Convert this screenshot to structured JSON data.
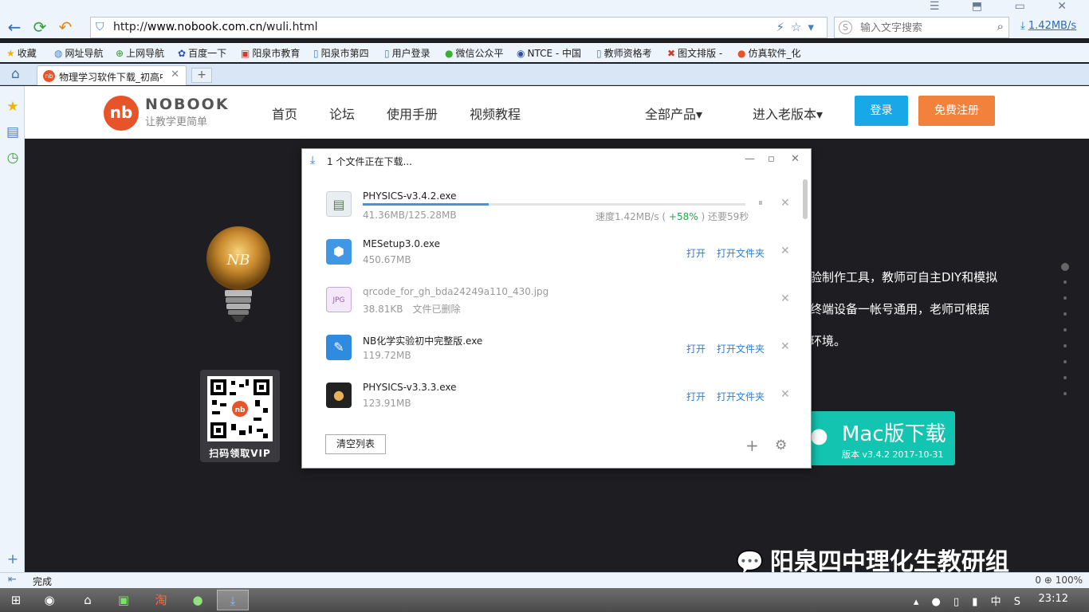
{
  "browser": {
    "url_prefix": "http://",
    "url_domain": "www.nobook.com.cn",
    "url_path": "/wuli.html",
    "search_placeholder": "输入文字搜索",
    "download_rate": "1.42MB/s",
    "bookmarks": [
      {
        "label": "收藏",
        "icon": "star-icon"
      },
      {
        "label": "网址导航",
        "icon": "globe-icon"
      },
      {
        "label": "上网导航",
        "icon": "plus-circle-icon"
      },
      {
        "label": "百度一下",
        "icon": "baidu-icon"
      },
      {
        "label": "阳泉市教育",
        "icon": "page-icon"
      },
      {
        "label": "阳泉市第四",
        "icon": "page-icon"
      },
      {
        "label": "用户登录",
        "icon": "page-icon"
      },
      {
        "label": "微信公众平",
        "icon": "wechat-icon"
      },
      {
        "label": "NTCE - 中国",
        "icon": "ntce-icon"
      },
      {
        "label": "教师资格考",
        "icon": "page-icon"
      },
      {
        "label": "图文排版 -",
        "icon": "layout-icon"
      },
      {
        "label": "仿真软件_化",
        "icon": "nobook-icon"
      }
    ],
    "tab_title": "物理学习软件下载_初高中",
    "status_text": "完成",
    "zoom": "100%",
    "status_count": "0"
  },
  "site": {
    "logo_mark": "nb",
    "logo_name": "NOBOOK",
    "logo_slogan": "让教学更简单",
    "nav": [
      "首页",
      "论坛",
      "使用手册",
      "视频教程"
    ],
    "products": "全部产品",
    "old_version": "进入老版本",
    "login": "登录",
    "register": "免费注册",
    "qr_caption": "扫码领取VIP",
    "desc_lines": [
      "验制作工具，教师可自主DIY和模拟",
      "终端设备一帐号通用，老师可根据",
      "环境。"
    ],
    "mac_title": "Mac版下载",
    "mac_version": "版本 v3.4.2   2017-10-31",
    "watermark": "阳泉四中理化生教研组"
  },
  "download_dialog": {
    "title": "1 个文件正在下载...",
    "items": [
      {
        "name": "PHYSICS-v3.4.2.exe",
        "size": "41.36MB/125.28MB",
        "progress": 0.33,
        "speed_prefix": "速度1.42MB/s ( ",
        "speed_pct": "+58%",
        "speed_suffix": " ) 还要59秒",
        "icon": "physics-setup-icon"
      },
      {
        "name": "MESetup3.0.exe",
        "size": "450.67MB",
        "open": "打开",
        "folder": "打开文件夹",
        "icon": "setup-box-icon"
      },
      {
        "name": "qrcode_for_gh_bda24249a110_430.jpg",
        "size": "38.81KB",
        "deleted": "文件已删除",
        "icon": "jpg-file-icon"
      },
      {
        "name": "NB化学实验初中完整版.exe",
        "size": "119.72MB",
        "open": "打开",
        "folder": "打开文件夹",
        "icon": "chemistry-app-icon"
      },
      {
        "name": "PHYSICS-v3.3.3.exe",
        "size": "123.91MB",
        "open": "打开",
        "folder": "打开文件夹",
        "icon": "physics-app-icon"
      }
    ],
    "clear_label": "清空列表"
  },
  "taskbar": {
    "clock": "23:12",
    "ime": "中"
  },
  "colors": {
    "accent_blue": "#18a8e8",
    "register_orange": "#f2823b",
    "mac_teal": "#13c4b0",
    "brand_red": "#e8542a",
    "progress_blue": "#4a90e2"
  }
}
